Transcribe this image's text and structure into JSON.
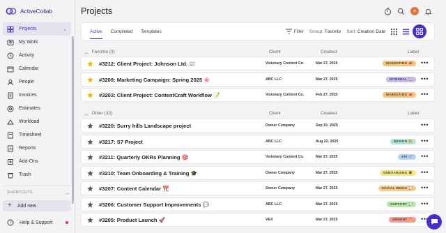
{
  "app": {
    "name": "ActiveCollab"
  },
  "sidebar": {
    "items": [
      {
        "label": "Projects",
        "icon": "projects-icon",
        "active": true
      },
      {
        "label": "My Work",
        "icon": "my-work-icon"
      },
      {
        "label": "Activity",
        "icon": "activity-icon"
      },
      {
        "label": "Calendar",
        "icon": "calendar-icon"
      },
      {
        "label": "People",
        "icon": "people-icon"
      },
      {
        "label": "Invoices",
        "icon": "invoices-icon"
      },
      {
        "label": "Estimates",
        "icon": "estimates-icon"
      },
      {
        "label": "Workload",
        "icon": "workload-icon"
      },
      {
        "label": "Timesheet",
        "icon": "timesheet-icon"
      },
      {
        "label": "Reports",
        "icon": "reports-icon"
      },
      {
        "label": "Add-Ons",
        "icon": "add-ons-icon"
      },
      {
        "label": "Trash",
        "icon": "trash-icon"
      }
    ],
    "shortcuts_label": "SHORTCUTS",
    "add_new_label": "Add new",
    "help_label": "Help & Support"
  },
  "header": {
    "title": "Projects"
  },
  "toolbar": {
    "tabs": [
      "Active",
      "Completed",
      "Templates"
    ],
    "filter_label": "Filter",
    "group_label": "Group:",
    "group_value": "Favorite",
    "sort_label": "Sort:",
    "sort_value": "Creation Date"
  },
  "columns": {
    "client": "Client",
    "created": "Created",
    "label": "Label"
  },
  "groups": {
    "favorite": {
      "name": "Favorite (3)"
    },
    "other": {
      "name": "Other (32)"
    }
  },
  "projects": [
    {
      "title": "#3212: Client Project: Johnson Ltd. 📰",
      "client": "Visionary Content Co.",
      "created": "Mar 27. 2025",
      "label": "MARKETING 📣",
      "favorite": true,
      "badge_bg": "#f7c27a"
    },
    {
      "title": "#3209: Marketing Campaign: Spring 2025 🌸",
      "client": "ABC LLC",
      "created": "Mar 27. 2025",
      "label": "INTERNAL 🏠",
      "favorite": true,
      "badge_bg": "#c9b8f2"
    },
    {
      "title": "#3203: Client Project: ContentCraft Workflow 📝",
      "client": "Visionary Content Co.",
      "created": "Feb 27. 2025",
      "label": "MARKETING 📣",
      "favorite": true,
      "badge_bg": "#f7c27a"
    },
    {
      "title": "#3220: Surry hills Landscape project",
      "client": "Owner Company",
      "created": "Sep 15. 2025",
      "label": "",
      "favorite": false,
      "badge_bg": ""
    },
    {
      "title": "#3217: S7 Project",
      "client": "ABC LLC",
      "created": "Aug 22. 2025",
      "label": "DESIGN 🎨",
      "favorite": false,
      "badge_bg": "#aee6d2"
    },
    {
      "title": "#3211: Quarterly OKRs Planning 🎯",
      "client": "Visionary Content Co.",
      "created": "Mar 27. 2025",
      "label": "API 🔗",
      "favorite": false,
      "badge_bg": "#b3d4f5"
    },
    {
      "title": "#3210: Team Onboarding & Training 🎓",
      "client": "Owner Company",
      "created": "Mar 27. 2025",
      "label": "ONBOARDING 🎓",
      "favorite": false,
      "badge_bg": "#f5e58a"
    },
    {
      "title": "#3207: Content Calendar 📆",
      "client": "Owner Company",
      "created": "Mar 27. 2025",
      "label": "SOCIAL MEDIA 💬",
      "favorite": false,
      "badge_bg": "#f9c98a"
    },
    {
      "title": "#3206: Customer Support Improvements 💬",
      "client": "ABC LLC",
      "created": "Mar 27. 2025",
      "label": "SUPPORT 💬",
      "favorite": false,
      "badge_bg": "#b9e8a6"
    },
    {
      "title": "#3205: Product Launch 🚀",
      "client": "VEX",
      "created": "Mar 27. 2025",
      "label": "URGENT 🔥",
      "favorite": false,
      "badge_bg": "#f59b93"
    }
  ],
  "colors": {
    "accent": "#4a2ec7",
    "star_favorite": "#f4b400",
    "star_other": "#555555"
  }
}
